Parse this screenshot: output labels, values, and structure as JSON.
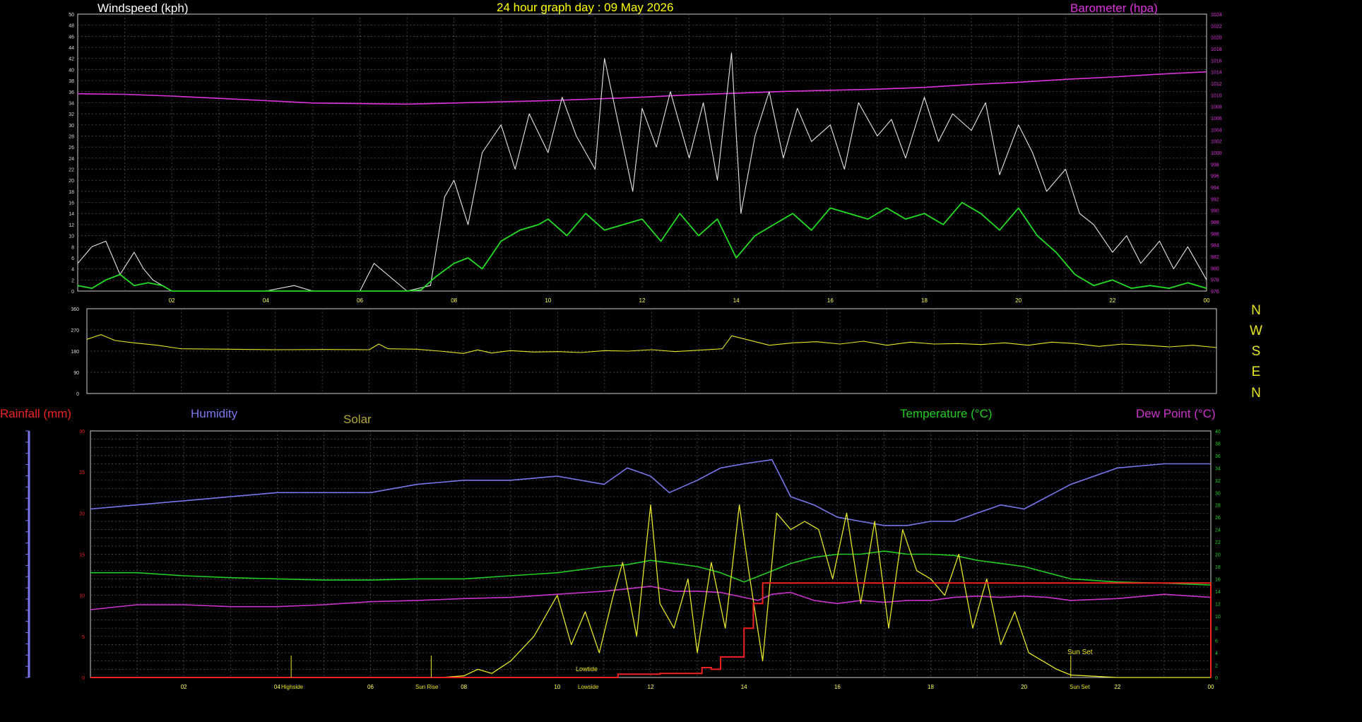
{
  "colors": {
    "background": "#000000",
    "grid": "#5a5a5a",
    "axis": "#cfcfcf",
    "windspeed": "#e6e6e6",
    "wind_avg": "#22dd22",
    "barometer": "#dd33dd",
    "direction": "#e6e62a",
    "humidity": "#7777ee",
    "solar": "#e6e62a",
    "temperature": "#22cc22",
    "dewpoint": "#cc33cc",
    "rainfall": "#ee2222",
    "title": "#ffff00"
  },
  "headings": {
    "windspeed": "Windspeed (kph)",
    "title": "24 hour graph day : 09 May 2026",
    "barometer": "Barometer (hpa)",
    "rainfall": "Rainfall (mm)",
    "humidity": "Humidity",
    "solar": "Solar",
    "temperature": "Temperature (°C)",
    "dewpoint": "Dew Point (°C)"
  },
  "compass": [
    "N",
    "W",
    "S",
    "E",
    "N"
  ],
  "x_ticks": [
    "02",
    "04",
    "06",
    "08",
    "10",
    "12",
    "14",
    "16",
    "18",
    "20",
    "22",
    "00"
  ],
  "annotations": {
    "highside": "Highside",
    "sunrise": "Sun Rise",
    "lowside": "Lowside",
    "lowtide": "Lowtide",
    "sunset_axis": "Sun Set",
    "sunset": "Sun Set"
  },
  "chart_data": [
    {
      "type": "line",
      "ylabel": "Windspeed (kph)",
      "ylim": [
        0,
        50
      ],
      "y2label": "Barometer (hpa)",
      "y2lim": [
        976,
        1024
      ],
      "x_unit": "hours",
      "xlim": [
        0,
        24
      ],
      "series": [
        {
          "name": "Windspeed (kph)",
          "x": [
            0,
            0.3,
            0.6,
            0.9,
            1.2,
            1.4,
            1.6,
            2,
            4,
            4.6,
            5,
            6,
            6.3,
            7,
            7.5,
            7.8,
            8,
            8.3,
            8.6,
            9,
            9.3,
            9.6,
            10,
            10.3,
            10.6,
            11,
            11.2,
            11.5,
            11.8,
            12,
            12.3,
            12.6,
            13,
            13.3,
            13.6,
            13.9,
            14.1,
            14.4,
            14.7,
            15,
            15.3,
            15.6,
            16,
            16.3,
            16.6,
            17,
            17.3,
            17.6,
            18,
            18.3,
            18.6,
            19,
            19.3,
            19.6,
            20,
            20.3,
            20.6,
            21,
            21.3,
            21.6,
            22,
            22.3,
            22.6,
            23,
            23.3,
            23.6,
            24
          ],
          "values": [
            5,
            8,
            9,
            3,
            7,
            4,
            2,
            0,
            0,
            1,
            0,
            0,
            5,
            0,
            1,
            17,
            20,
            12,
            25,
            30,
            22,
            32,
            25,
            35,
            28,
            22,
            42,
            30,
            18,
            33,
            26,
            36,
            24,
            34,
            20,
            43,
            14,
            28,
            36,
            24,
            33,
            27,
            30,
            22,
            34,
            28,
            31,
            24,
            35,
            27,
            32,
            29,
            34,
            21,
            30,
            25,
            18,
            22,
            14,
            12,
            7,
            10,
            5,
            9,
            4,
            8,
            2
          ]
        },
        {
          "name": "Average windspeed",
          "x": [
            0,
            0.3,
            0.6,
            0.9,
            1.2,
            1.5,
            1.8,
            2,
            6,
            7,
            7.3,
            7.6,
            8,
            8.3,
            8.6,
            9,
            9.4,
            9.8,
            10,
            10.4,
            10.8,
            11.2,
            11.6,
            12,
            12.4,
            12.8,
            13.2,
            13.6,
            14,
            14.4,
            14.8,
            15.2,
            15.6,
            16,
            16.4,
            16.8,
            17.2,
            17.6,
            18,
            18.4,
            18.8,
            19.2,
            19.6,
            20,
            20.4,
            20.8,
            21.2,
            21.6,
            22,
            22.4,
            22.8,
            23.2,
            23.6,
            24
          ],
          "values": [
            1,
            0.5,
            2,
            3,
            1,
            1.5,
            1,
            0,
            0,
            0,
            0.2,
            2.5,
            5,
            6,
            4,
            9,
            11,
            12,
            13,
            10,
            14,
            11,
            12,
            13,
            9,
            14,
            10,
            13,
            6,
            10,
            12,
            14,
            11,
            15,
            14,
            13,
            15,
            13,
            14,
            12,
            16,
            14,
            11,
            15,
            10,
            7,
            3,
            1,
            2,
            0.5,
            1,
            0.5,
            1.5,
            0.5
          ]
        },
        {
          "name": "Barometer (hpa)",
          "axis": "y2",
          "x": [
            0,
            1,
            2,
            3,
            4,
            5,
            6,
            7,
            8,
            9,
            10,
            11,
            12,
            13,
            14,
            15,
            16,
            17,
            18,
            19,
            20,
            21,
            22,
            23,
            24
          ],
          "values": [
            1010.2,
            1010.1,
            1009.8,
            1009.4,
            1009.0,
            1008.6,
            1008.5,
            1008.4,
            1008.6,
            1008.8,
            1009.0,
            1009.3,
            1009.6,
            1010.0,
            1010.3,
            1010.6,
            1010.8,
            1011.0,
            1011.3,
            1011.8,
            1012.2,
            1012.7,
            1013.1,
            1013.6,
            1014.0
          ]
        }
      ]
    },
    {
      "type": "line",
      "ylim": [
        0,
        360
      ],
      "y_ticks": [
        0,
        90,
        180,
        270,
        360
      ],
      "xlim": [
        0,
        24
      ],
      "series": [
        {
          "name": "Wind direction",
          "x": [
            0,
            0.3,
            0.6,
            1,
            1.5,
            2,
            3,
            4,
            5,
            6,
            6.2,
            6.4,
            7,
            7.5,
            8,
            8.3,
            8.6,
            9,
            9.5,
            10,
            10.5,
            11,
            11.5,
            12,
            12.5,
            13,
            13.5,
            13.7,
            14,
            14.5,
            15,
            15.5,
            16,
            16.5,
            17,
            17.5,
            18,
            18.5,
            19,
            19.5,
            20,
            20.5,
            21,
            21.5,
            22,
            22.5,
            23,
            23.5,
            24
          ],
          "values": [
            230,
            250,
            225,
            215,
            205,
            190,
            188,
            186,
            187,
            186,
            210,
            190,
            188,
            180,
            170,
            185,
            172,
            182,
            176,
            178,
            174,
            182,
            180,
            186,
            178,
            184,
            190,
            245,
            230,
            205,
            215,
            220,
            210,
            222,
            205,
            218,
            210,
            212,
            208,
            215,
            205,
            218,
            212,
            200,
            210,
            205,
            198,
            205,
            195
          ]
        }
      ]
    },
    {
      "type": "line",
      "ylabel": "Rainfall (mm)",
      "ylim": [
        0,
        30
      ],
      "y2label": "Temperature (°C)",
      "y2lim": [
        0,
        40
      ],
      "xlim": [
        0,
        24
      ],
      "series": [
        {
          "name": "Humidity",
          "axis": "y",
          "x": [
            0,
            1,
            2,
            3,
            4,
            5,
            6,
            7,
            8,
            9,
            10,
            11,
            11.5,
            12,
            12.4,
            13,
            13.5,
            14,
            14.6,
            15,
            15.5,
            16,
            16.5,
            17,
            17.5,
            18,
            18.5,
            19,
            19.5,
            20,
            20.5,
            21,
            22,
            23,
            24
          ],
          "values": [
            20.5,
            21,
            21.5,
            22,
            22.5,
            22.5,
            22.5,
            23.5,
            24,
            24,
            24.5,
            23.5,
            25.5,
            24.5,
            22.5,
            24,
            25.5,
            26,
            26.5,
            22,
            21,
            19.5,
            19,
            18.5,
            18.5,
            19,
            19,
            20,
            21,
            20.5,
            22,
            23.5,
            25.5,
            26,
            26
          ]
        },
        {
          "name": "Solar",
          "axis": "y",
          "x": [
            0,
            7.5,
            8,
            8.3,
            8.6,
            9,
            9.5,
            10,
            10.3,
            10.6,
            10.9,
            11.2,
            11.4,
            11.7,
            12,
            12.2,
            12.5,
            12.8,
            13,
            13.3,
            13.6,
            13.9,
            14.1,
            14.4,
            14.7,
            15,
            15.3,
            15.6,
            15.9,
            16.2,
            16.5,
            16.8,
            17.1,
            17.4,
            17.7,
            18,
            18.3,
            18.6,
            18.9,
            19.2,
            19.5,
            19.8,
            20.1,
            20.4,
            20.7,
            21,
            22,
            24
          ],
          "values": [
            0,
            0,
            0.2,
            1,
            0.5,
            2,
            5,
            10,
            4,
            8,
            3,
            10,
            14,
            5,
            21,
            9,
            6,
            12,
            3,
            14,
            6,
            21,
            13,
            2,
            20,
            18,
            19,
            18,
            12,
            20,
            9,
            19,
            6,
            18,
            13,
            12,
            10,
            15,
            6,
            12,
            4,
            8,
            3,
            2,
            1,
            0.3,
            0,
            0
          ]
        },
        {
          "name": "Temperature (°C)",
          "axis": "y2",
          "x": [
            0,
            1,
            2,
            3,
            4,
            5,
            6,
            7,
            8,
            9,
            10,
            11,
            11.5,
            12,
            12.5,
            13,
            13.5,
            14,
            14.5,
            15,
            15.5,
            16,
            16.5,
            17,
            17.5,
            18,
            18.5,
            19,
            19.5,
            20,
            20.5,
            21,
            22,
            23,
            24
          ],
          "values": [
            17,
            17,
            16.5,
            16.2,
            16,
            15.8,
            15.8,
            16,
            16,
            16.5,
            17,
            18,
            18.3,
            19,
            18.5,
            18,
            17,
            15.5,
            17,
            18.5,
            19.5,
            20,
            20,
            20.5,
            20,
            20,
            19.8,
            19,
            18.5,
            18,
            17,
            16,
            15.5,
            15.3,
            15
          ]
        },
        {
          "name": "Dew Point (°C)",
          "axis": "y2",
          "x": [
            0,
            1,
            2,
            3,
            4,
            5,
            6,
            7,
            8,
            9,
            10,
            11,
            12,
            12.5,
            13,
            13.5,
            14,
            14.3,
            14.6,
            15,
            15.5,
            16,
            16.5,
            17,
            17.5,
            18,
            18.5,
            19,
            19.5,
            20,
            20.5,
            21,
            22,
            23,
            24
          ],
          "values": [
            11,
            11.8,
            11.8,
            11.5,
            11.5,
            11.8,
            12.3,
            12.5,
            12.8,
            13,
            13.5,
            14,
            14.8,
            14,
            14,
            13.8,
            13,
            12.5,
            13.5,
            13.8,
            12.5,
            12,
            12.5,
            12.2,
            12.5,
            12.5,
            13,
            13.2,
            13,
            13.2,
            13,
            12.5,
            12.8,
            13.5,
            13
          ]
        },
        {
          "name": "Rainfall (mm)",
          "axis": "y",
          "x": [
            0,
            11,
            11.3,
            12,
            12.2,
            13,
            13.1,
            13.3,
            13.5,
            13.8,
            14,
            14.2,
            14.4,
            24,
            24,
            24
          ],
          "values": [
            0,
            0,
            0.4,
            0.4,
            0.5,
            0.5,
            1.2,
            1,
            2.5,
            2.5,
            6,
            9,
            11.5,
            11.5,
            0,
            0
          ]
        }
      ]
    }
  ]
}
